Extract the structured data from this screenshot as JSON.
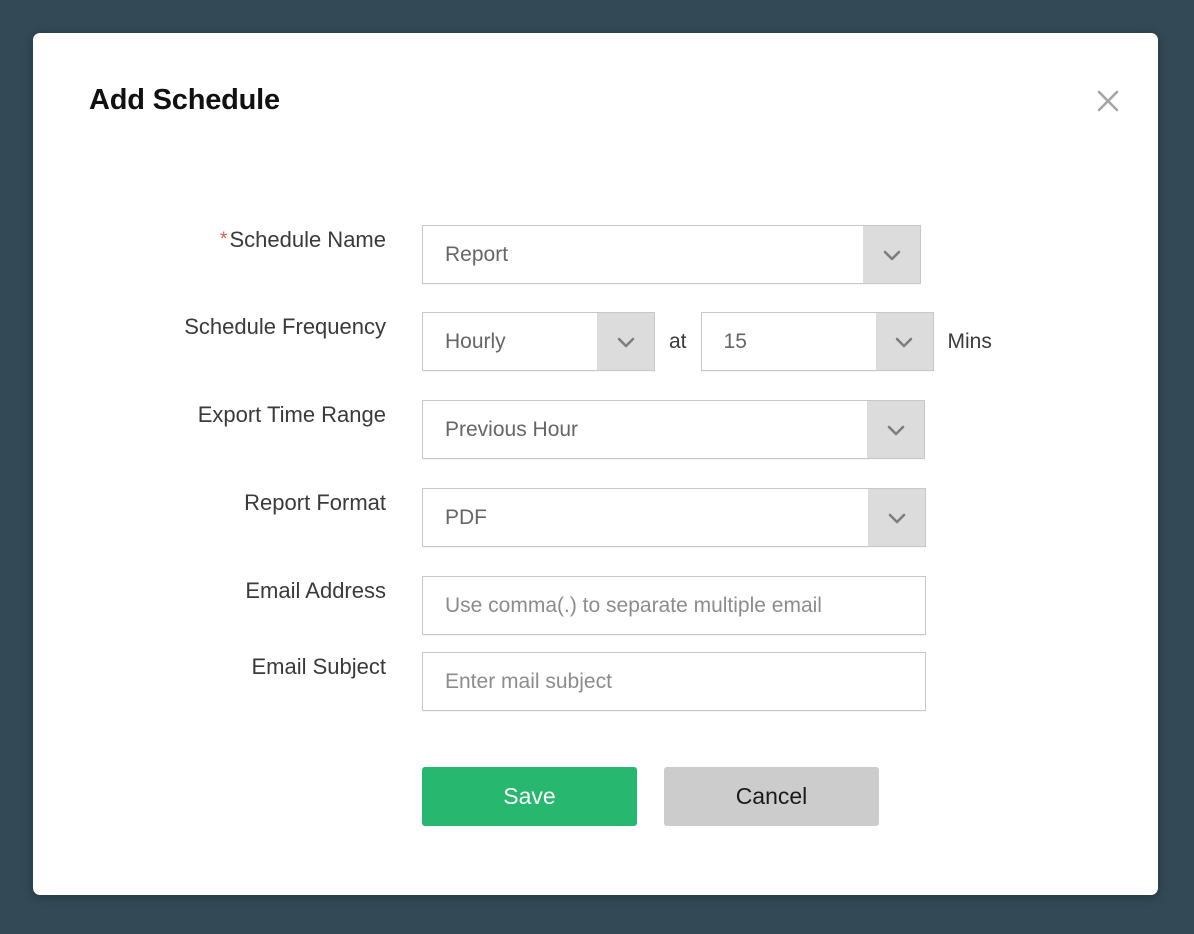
{
  "dialog": {
    "title": "Add Schedule",
    "close_icon": "close-icon"
  },
  "fields": {
    "schedule_name": {
      "label": "Schedule Name",
      "required_marker": "*",
      "value": "Report"
    },
    "schedule_frequency": {
      "label": "Schedule Frequency",
      "value": "Hourly",
      "at_label": "at",
      "minutes_value": "15",
      "minutes_unit": "Mins"
    },
    "export_time_range": {
      "label": "Export Time Range",
      "value": "Previous Hour"
    },
    "report_format": {
      "label": "Report Format",
      "value": "PDF"
    },
    "email_address": {
      "label": "Email Address",
      "value": "",
      "placeholder": "Use comma(.) to separate multiple email"
    },
    "email_subject": {
      "label": "Email Subject",
      "value": "",
      "placeholder": "Enter mail subject"
    }
  },
  "actions": {
    "save_label": "Save",
    "cancel_label": "Cancel"
  },
  "colors": {
    "page_background": "#334956",
    "dialog_background": "#ffffff",
    "save_button": "#27b76e",
    "cancel_button": "#cccccc",
    "required_asterisk": "#e8554a",
    "dropdown_arrow_button": "#dcdcdc",
    "field_border": "#c8c8c8"
  }
}
